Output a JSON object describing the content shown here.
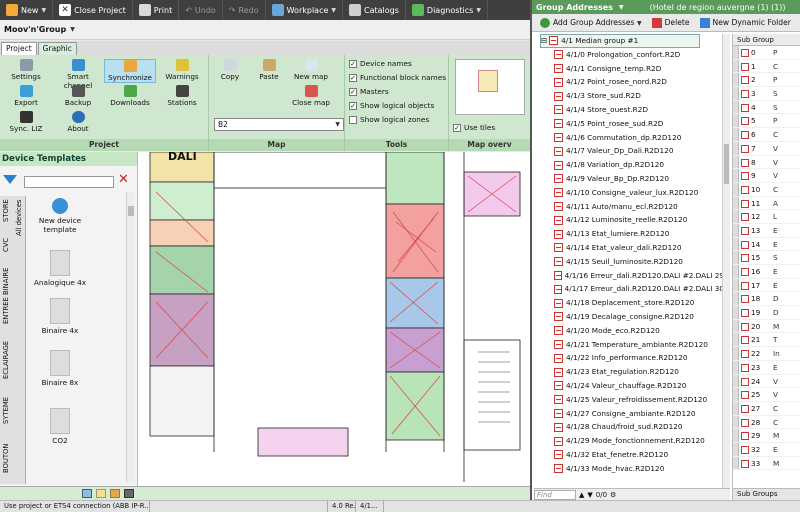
{
  "toolbar": {
    "new": "New",
    "close_project": "Close Project",
    "print": "Print",
    "undo": "Undo",
    "redo": "Redo",
    "workplace": "Workplace",
    "catalogs": "Catalogs",
    "diagnostics": "Diagnostics"
  },
  "project_title": "Moov'n'Group",
  "tabs": [
    "Project",
    "Graphic"
  ],
  "ribbon": {
    "project": {
      "label": "Project",
      "buttons": [
        "Settings",
        "Smart channel",
        "Synchronize",
        "Warnings",
        "Export",
        "Backup",
        "Downloads",
        "Stations",
        "Sync. LIZ",
        "About"
      ]
    },
    "map": {
      "label": "Map",
      "buttons": [
        "Copy",
        "Paste",
        "New map",
        "Close map"
      ],
      "selected_map": "B2"
    },
    "tools": {
      "label": "Tools",
      "options": [
        {
          "label": "Device names",
          "checked": true
        },
        {
          "label": "Functional block names",
          "checked": true
        },
        {
          "label": "Masters",
          "checked": true
        },
        {
          "label": "Show logical objects",
          "checked": true
        },
        {
          "label": "Show logical zones",
          "checked": false
        }
      ]
    },
    "overview": {
      "label": "Map overv",
      "use_tiles": "Use tiles"
    }
  },
  "device_templates": {
    "title": "Device Templates",
    "vertical_tabs": [
      "STORE",
      "All devices",
      "CVC",
      "ENTREE BINAIRE",
      "ECLAIRAGE",
      "SYTEME",
      "BOUTON"
    ],
    "items": [
      "New device template",
      "Analogique 4x",
      "Binaire 4x",
      "Binaire 8x",
      "CO2"
    ]
  },
  "canvas": {
    "room_label": "DALI"
  },
  "status": [
    "Use project or ETS4 connection (ABB IP-R...",
    "4.0 Re...",
    "4/1..."
  ],
  "group_addresses": {
    "title": "Group Addresses",
    "context": "(Hotel de region auvergne (1) (1))",
    "tools": [
      "Add Group Addresses",
      "Delete",
      "New Dynamic Folder"
    ],
    "root": "4/1 Median group #1",
    "items": [
      "4/1/0 Prolongation_confort.R2D",
      "4/1/1 Consigne_temp.R2D",
      "4/1/2 Point_rosee_nord.R2D",
      "4/1/3 Store_sud.R2D",
      "4/1/4 Store_ouest.R2D",
      "4/1/5 Point_rosee_sud.R2D",
      "4/1/6 Commutation_dp.R2D120",
      "4/1/7 Valeur_Dp_Dali.R2D120",
      "4/1/8 Variation_dp.R2D120",
      "4/1/9 Valeur_Bp_Dp.R2D120",
      "4/1/10 Consigne_valeur_lux.R2D120",
      "4/1/11 Auto/manu_ecl.R2D120",
      "4/1/12 Luminosite_reelle.R2D120",
      "4/1/13 Etat_lumiere.R2D120",
      "4/1/14 Etat_valeur_dali.R2D120",
      "4/1/15 Seuil_luminosite.R2D120",
      "4/1/16 Erreur_dali.R2D120.DALI #2.DALI 29",
      "4/1/17 Erreur_dali.R2D120.DALI #2.DALI 30",
      "4/1/18 Deplacement_store.R2D120",
      "4/1/19 Decalage_consigne.R2D120",
      "4/1/20 Mode_eco.R2D120",
      "4/1/21 Temperature_ambiante.R2D120",
      "4/1/22 Info_performance.R2D120",
      "4/1/23 Etat_regulation.R2D120",
      "4/1/24 Valeur_chauffage.R2D120",
      "4/1/25 Valeur_refroidissement.R2D120",
      "4/1/27 Consigne_ambiante.R2D120",
      "4/1/28 Chaud/froid_sud.R2D120",
      "4/1/29 Mode_fonctionnement.R2D120",
      "4/1/32 Etat_fenetre.R2D120",
      "4/1/33 Mode_hvac.R2D120"
    ],
    "find_placeholder": "Find",
    "find_count": "0/0",
    "subgroup_header": "Sub Group",
    "subgroup_rows": [
      {
        "n": "0",
        "c": "P"
      },
      {
        "n": "1",
        "c": "C"
      },
      {
        "n": "2",
        "c": "P"
      },
      {
        "n": "3",
        "c": "S"
      },
      {
        "n": "4",
        "c": "S"
      },
      {
        "n": "5",
        "c": "P"
      },
      {
        "n": "6",
        "c": "C"
      },
      {
        "n": "7",
        "c": "V"
      },
      {
        "n": "8",
        "c": "V"
      },
      {
        "n": "9",
        "c": "V"
      },
      {
        "n": "10",
        "c": "C"
      },
      {
        "n": "11",
        "c": "A"
      },
      {
        "n": "12",
        "c": "L"
      },
      {
        "n": "13",
        "c": "E"
      },
      {
        "n": "14",
        "c": "E"
      },
      {
        "n": "15",
        "c": "S"
      },
      {
        "n": "16",
        "c": "E"
      },
      {
        "n": "17",
        "c": "E"
      },
      {
        "n": "18",
        "c": "D"
      },
      {
        "n": "19",
        "c": "D"
      },
      {
        "n": "20",
        "c": "M"
      },
      {
        "n": "21",
        "c": "T"
      },
      {
        "n": "22",
        "c": "In"
      },
      {
        "n": "23",
        "c": "E"
      },
      {
        "n": "24",
        "c": "V"
      },
      {
        "n": "25",
        "c": "V"
      },
      {
        "n": "27",
        "c": "C"
      },
      {
        "n": "28",
        "c": "C"
      },
      {
        "n": "29",
        "c": "M"
      },
      {
        "n": "32",
        "c": "E"
      },
      {
        "n": "33",
        "c": "M"
      }
    ],
    "subgroups_tab": "Sub Groups"
  }
}
